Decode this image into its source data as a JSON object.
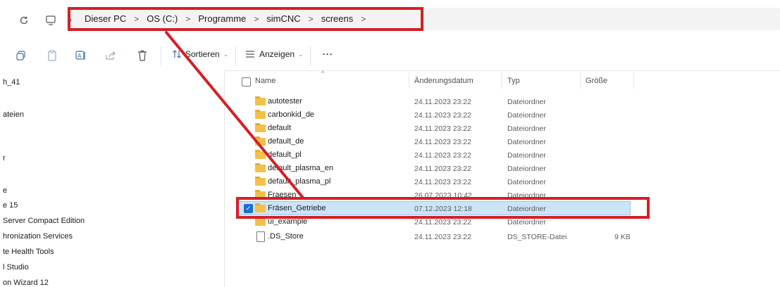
{
  "nav": {
    "refresh_icon": "refresh-icon",
    "pc_icon": "monitor-icon"
  },
  "breadcrumb": [
    "Dieser PC",
    "OS (C:)",
    "Programme",
    "simCNC",
    "screens"
  ],
  "toolbar": {
    "sort_label": "Sortieren",
    "view_label": "Anzeigen",
    "more_label": "···"
  },
  "sidebar": {
    "items": [
      "h_41",
      "ateien",
      "r",
      "e",
      "e 15",
      "Server Compact Edition",
      "hronization Services",
      "te Health Tools",
      "l Studio",
      "on Wizard 12"
    ]
  },
  "columns": {
    "name": "Name",
    "date": "Änderungsdatum",
    "type": "Typ",
    "size": "Größe"
  },
  "files": [
    {
      "name": "autotester",
      "date": "24.11.2023 23:22",
      "type": "Dateiordner",
      "size": ""
    },
    {
      "name": "carbonkid_de",
      "date": "24.11.2023 23:22",
      "type": "Dateiordner",
      "size": ""
    },
    {
      "name": "default",
      "date": "24.11.2023 23:22",
      "type": "Dateiordner",
      "size": ""
    },
    {
      "name": "default_de",
      "date": "24.11.2023 23:22",
      "type": "Dateiordner",
      "size": ""
    },
    {
      "name": "default_pl",
      "date": "24.11.2023 23:22",
      "type": "Dateiordner",
      "size": ""
    },
    {
      "name": "default_plasma_en",
      "date": "24.11.2023 23:22",
      "type": "Dateiordner",
      "size": ""
    },
    {
      "name": "default_plasma_pl",
      "date": "24.11.2023 23:22",
      "type": "Dateiordner",
      "size": ""
    },
    {
      "name": "Fraesen",
      "date": "26.07.2023 10:42",
      "type": "Dateiordner",
      "size": ""
    },
    {
      "name": "Fräsen_Getriebe",
      "date": "07.12.2023 12:18",
      "type": "Dateiordner",
      "size": ""
    },
    {
      "name": "ui_example",
      "date": "24.11.2023 23:22",
      "type": "Dateiordner",
      "size": ""
    },
    {
      "name": ".DS_Store",
      "date": "24.11.2023 23:22",
      "type": "DS_STORE-Datei",
      "size": "9 KB"
    }
  ],
  "colors": {
    "annotation": "#d32026",
    "selection": "#cce4f7",
    "folder": "#f2c14b"
  }
}
